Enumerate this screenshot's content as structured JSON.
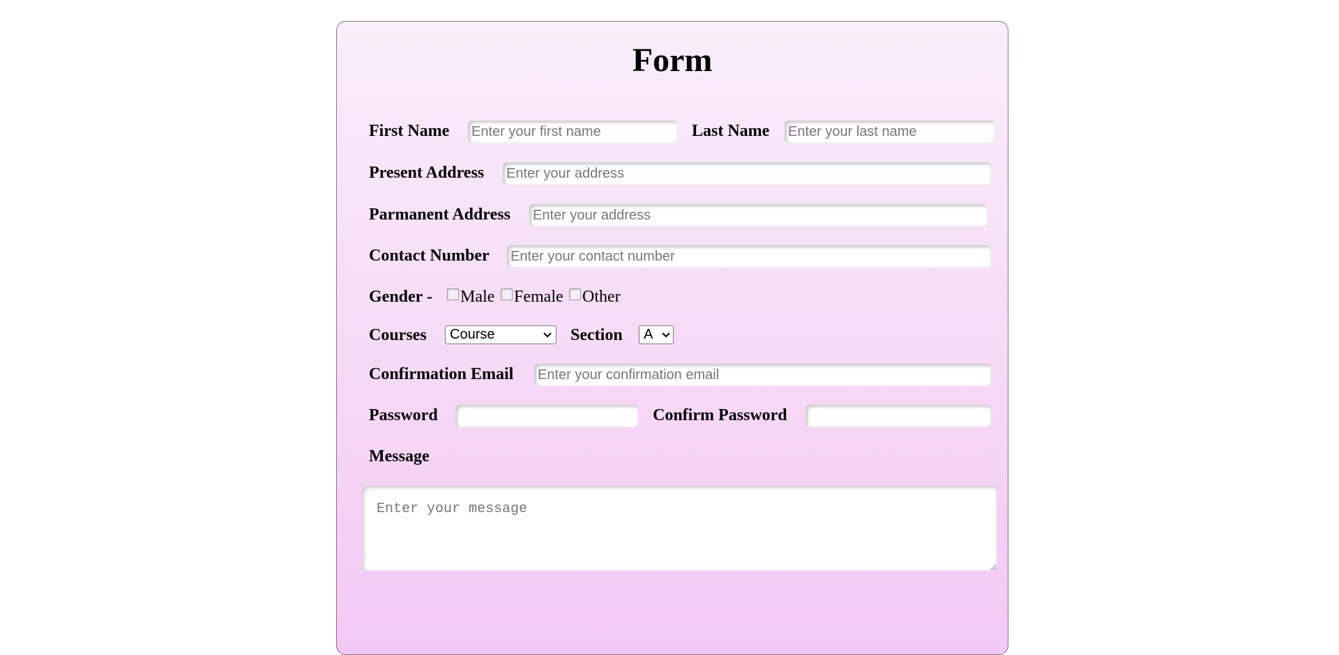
{
  "form": {
    "title": "Form",
    "first_name": {
      "label": "First Name",
      "placeholder": "Enter your first name",
      "value": ""
    },
    "last_name": {
      "label": "Last Name",
      "placeholder": "Enter your last name",
      "value": ""
    },
    "present_address": {
      "label": "Present Address",
      "placeholder": "Enter your address",
      "value": ""
    },
    "permanent_address": {
      "label": "Parmanent Address",
      "placeholder": "Enter your address",
      "value": ""
    },
    "contact_number": {
      "label": "Contact Number",
      "placeholder": "Enter your contact number",
      "value": ""
    },
    "gender": {
      "label": "Gender -",
      "options": [
        {
          "label": "Male",
          "checked": false
        },
        {
          "label": "Female",
          "checked": false
        },
        {
          "label": "Other",
          "checked": false
        }
      ]
    },
    "courses": {
      "label": "Courses",
      "selected": "Course"
    },
    "section": {
      "label": "Section",
      "selected": "A"
    },
    "confirmation_email": {
      "label": "Confirmation Email",
      "placeholder": "Enter your confirmation email",
      "value": ""
    },
    "password": {
      "label": "Password",
      "value": ""
    },
    "confirm_password": {
      "label": "Confirm Password",
      "value": ""
    },
    "message": {
      "label": "Message",
      "placeholder": "Enter your message",
      "value": ""
    }
  },
  "colors": {
    "card_top": "#f9eefa",
    "card_bottom": "#f3c8f5",
    "card_border": "#8a6d86"
  },
  "icons": {
    "select_arrow": "chevron-down-icon",
    "resize_handle": "resize-grip-icon"
  }
}
